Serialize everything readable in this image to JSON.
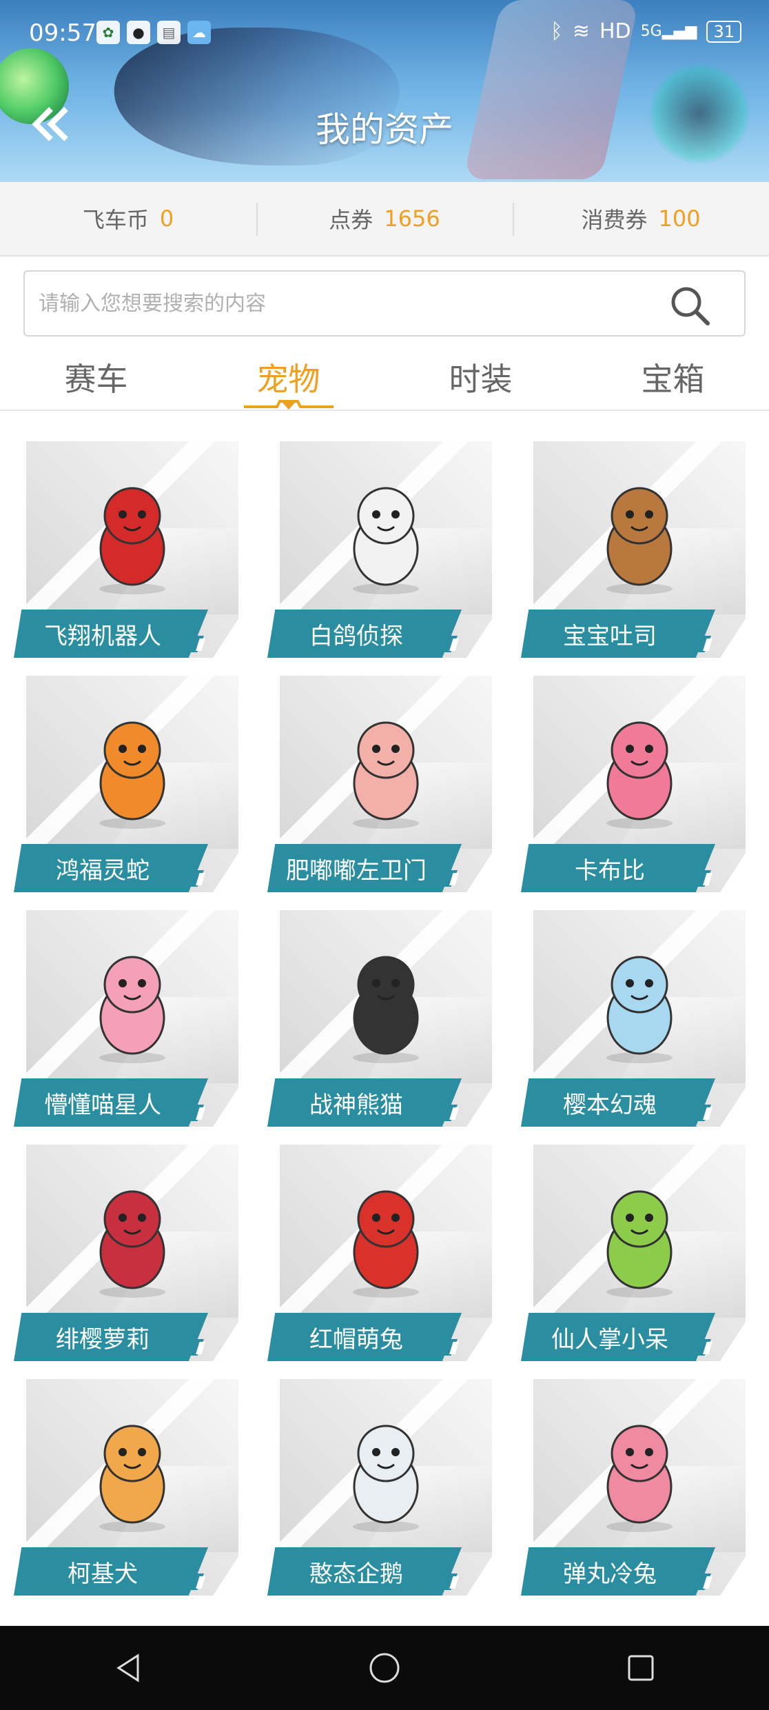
{
  "status_bar": {
    "time": "09:57",
    "network": "HD",
    "signal": "5G",
    "battery": "31"
  },
  "header": {
    "title": "我的资产"
  },
  "currencies": [
    {
      "label": "飞车币",
      "value": "0"
    },
    {
      "label": "点券",
      "value": "1656"
    },
    {
      "label": "消费券",
      "value": "100"
    }
  ],
  "search": {
    "placeholder": "请输入您想要搜索的内容"
  },
  "tabs": [
    {
      "label": "赛车",
      "active": false
    },
    {
      "label": "宠物",
      "active": true
    },
    {
      "label": "时装",
      "active": false
    },
    {
      "label": "宝箱",
      "active": false
    }
  ],
  "pets": [
    {
      "name": "飞翔机器人",
      "icon": "red-robot-pet",
      "color": "#d42a2a"
    },
    {
      "name": "白鸽侦探",
      "icon": "white-dove-detective-pet",
      "color": "#f2f2f2"
    },
    {
      "name": "宝宝吐司",
      "icon": "toast-face-pet",
      "color": "#b8783e"
    },
    {
      "name": "鸿福灵蛇",
      "icon": "orange-snake-pet",
      "color": "#f08a2a"
    },
    {
      "name": "肥嘟嘟左卫门",
      "icon": "pink-pig-man-pet",
      "color": "#f2b0a8"
    },
    {
      "name": "卡布比",
      "icon": "pink-bear-head-pet",
      "color": "#f07a98"
    },
    {
      "name": "懵懂喵星人",
      "icon": "cat-boy-pet",
      "color": "#f4a0b8"
    },
    {
      "name": "战神熊猫",
      "icon": "panda-warrior-pet",
      "color": "#333333"
    },
    {
      "name": "樱本幻魂",
      "icon": "ghost-rider-pet",
      "color": "#a8d8f0"
    },
    {
      "name": "绯樱萝莉",
      "icon": "sakura-girl-pet",
      "color": "#c83040"
    },
    {
      "name": "红帽萌兔",
      "icon": "red-hat-rabbit-pet",
      "color": "#d8322a"
    },
    {
      "name": "仙人掌小呆",
      "icon": "cactus-pet",
      "color": "#8ccc4a"
    },
    {
      "name": "柯基犬",
      "icon": "corgi-pet",
      "color": "#f0a84a"
    },
    {
      "name": "憨态企鹅",
      "icon": "penguin-pet",
      "color": "#e8eef2"
    },
    {
      "name": "弹丸冷兔",
      "icon": "pink-pig-pet",
      "color": "#f08aa0"
    }
  ],
  "nav": {
    "back": "back-triangle-icon",
    "home": "home-circle-icon",
    "recent": "recent-square-icon"
  }
}
